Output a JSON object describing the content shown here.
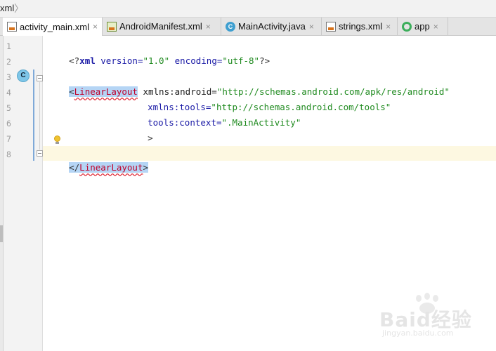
{
  "breadcrumb": {
    "item": "xml",
    "separator": "〉"
  },
  "tabs": [
    {
      "label": "activity_main.xml",
      "icon": "xml-layout-file-icon",
      "active": true
    },
    {
      "label": "AndroidManifest.xml",
      "icon": "manifest-file-icon",
      "active": false
    },
    {
      "label": "MainActivity.java",
      "icon": "java-class-icon",
      "active": false
    },
    {
      "label": "strings.xml",
      "icon": "xml-values-file-icon",
      "active": false
    },
    {
      "label": "app",
      "icon": "android-module-icon",
      "active": false
    }
  ],
  "tab_close_glyph": "×",
  "gutter": {
    "line_numbers": [
      "1",
      "2",
      "3",
      "4",
      "5",
      "6",
      "7",
      "8"
    ],
    "class_marker": "C"
  },
  "code": {
    "line1": {
      "open": "<?",
      "name": "xml",
      "attr1": " version=",
      "val1": "\"1.0\"",
      "attr2": " encoding=",
      "val2": "\"utf-8\"",
      "close": "?>"
    },
    "line3": {
      "lt": "<",
      "tag": "LinearLayout",
      "attr": " xmlns:android=",
      "val": "\"http://schemas.android.com/apk/res/android\""
    },
    "line4": {
      "attr": "xmlns:tools=",
      "val": "\"http://schemas.android.com/tools\""
    },
    "line5": {
      "attr": "tools:context=",
      "val": "\".MainActivity\""
    },
    "line6": {
      "gt": ">"
    },
    "line8": {
      "lt": "</",
      "tag": "LinearLayout",
      "gt": ">"
    }
  },
  "watermark": {
    "text": "Baid经验",
    "sub": "jingyan.baidu.com"
  },
  "colors": {
    "tag": "#c0002a",
    "selection": "#b5d5f5",
    "string": "#1f8a1f",
    "attribute_keyword": "#1a1aa6",
    "current_line": "#fdf8e1",
    "class_marker": "#7ec6e8"
  }
}
